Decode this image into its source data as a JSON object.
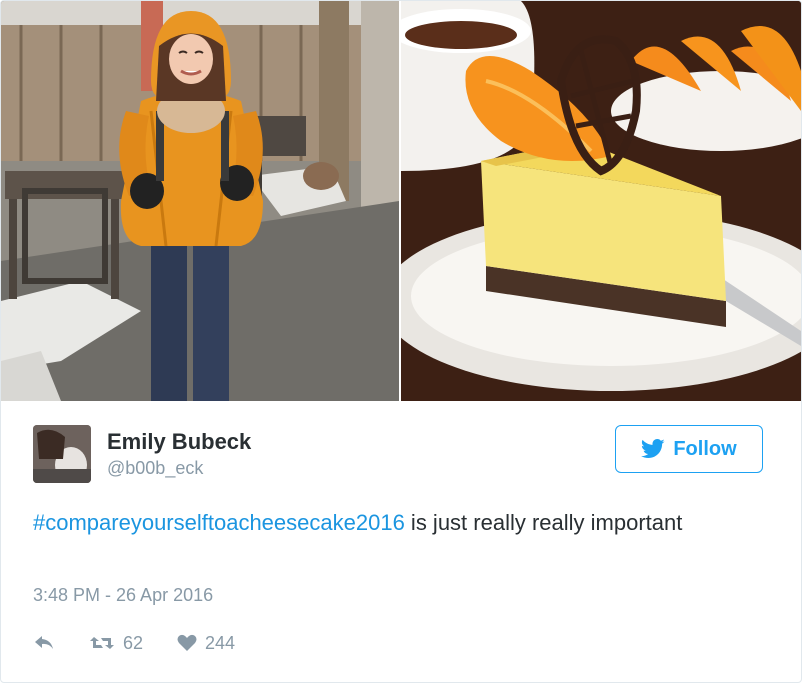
{
  "media": {
    "left_image": "woman-in-yellow-jacket-photo",
    "right_image": "orange-cheesecake-photo"
  },
  "author": {
    "name": "Emily Bubeck",
    "handle": "@b00b_eck"
  },
  "follow": {
    "label": "Follow",
    "icon": "twitter-bird-icon",
    "color": "#1da1f2"
  },
  "tweet": {
    "hashtag": "#compareyourselftoacheesecake2016",
    "text_rest": " is just really really important",
    "timestamp": "3:48 PM - 26 Apr 2016"
  },
  "stats": {
    "retweets": "62",
    "likes": "244"
  },
  "colors": {
    "link": "#1b95e0",
    "muted": "#8899a6",
    "text": "#292f33"
  }
}
